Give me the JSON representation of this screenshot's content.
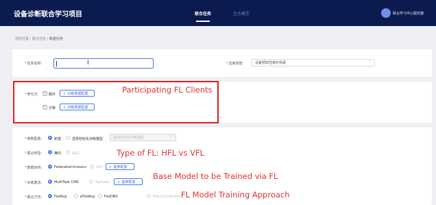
{
  "header": {
    "app_title": "设备诊断联合学习项目",
    "tabs": [
      {
        "label": "联合任务",
        "active": true
      },
      {
        "label": "生态模型",
        "active": false
      }
    ],
    "user_name": "联合学习中心服务器"
  },
  "breadcrumb": {
    "prefix": "您的位置：联合任务 / ",
    "current": "新建任务"
  },
  "task_form": {
    "name_label": "任务名称:",
    "name_value": "",
    "scene_label": "应用场景:",
    "scene_value": "设备预知性维护场景"
  },
  "participants": {
    "label": "参与方:",
    "rows": [
      {
        "name": "额外",
        "checked": true,
        "button": "训练数据配置"
      },
      {
        "name": "迁移",
        "checked": true,
        "button": "训练数据配置"
      }
    ]
  },
  "params": {
    "config_label": "参数配置:",
    "config_options": [
      "新建",
      "选择初始化训练模型"
    ],
    "config_select_placeholder": "选择初始化训练模型",
    "type_label": "联合类型:",
    "type_options": [
      "横向",
      "纵向"
    ],
    "model_label": "数据目构:",
    "model_options": [
      "Federated-kmeans",
      "LSH"
    ],
    "model_button": "超参配置",
    "algo_label": "训练算法:",
    "algo_options": [
      "MultiTask CNN",
      "Xgboost"
    ],
    "algo_button": "超参配置",
    "method_label": "联合方式:",
    "method_options": [
      "FedAvg",
      "pFedAvg",
      "FedOBD",
      "Fed-Contribution"
    ]
  },
  "annotations": [
    "Participating FL Clients",
    "Type of FL: HFL vs VFL",
    "Base Model to be Trained via FL",
    "FL Model Training Approach"
  ],
  "icons": {
    "chevron": "chevron-down-icon",
    "caret": "text-cursor-icon"
  },
  "colors": {
    "header_bg": "#0b1a4f",
    "accent": "#4d76e8",
    "annotation": "#e03131"
  }
}
